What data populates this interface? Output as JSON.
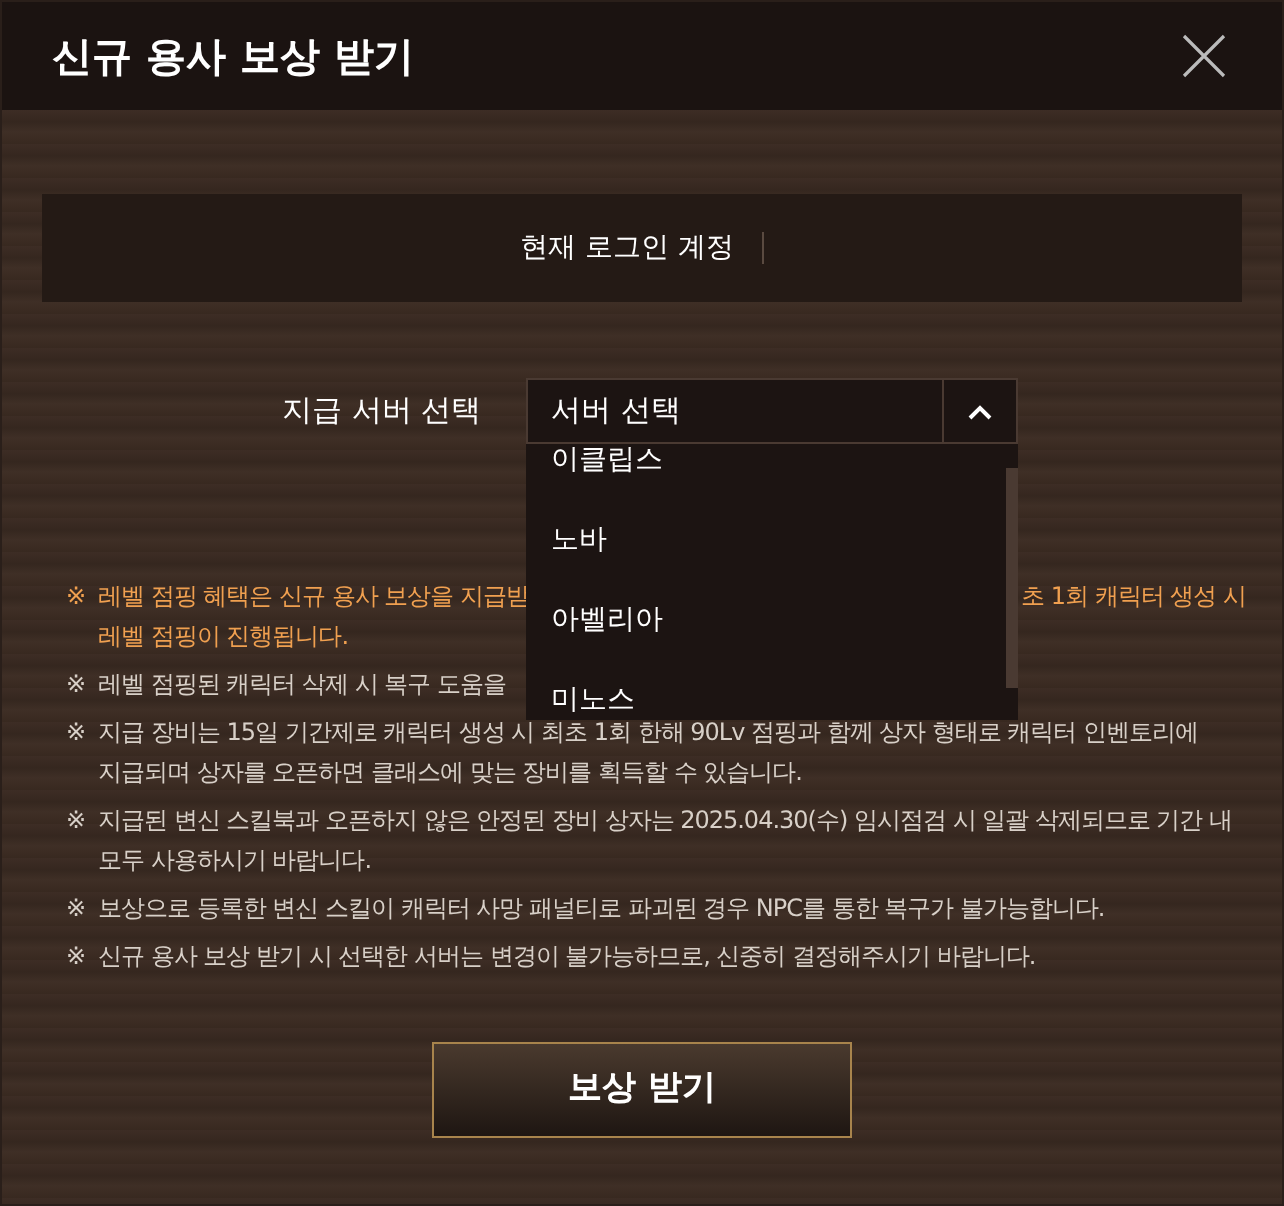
{
  "dialog": {
    "title": "신규 용사 보상 받기"
  },
  "account": {
    "label": "현재 로그인 계정"
  },
  "server_select": {
    "label": "지급 서버 선택",
    "value": "서버 선택",
    "expanded": true,
    "options": [
      {
        "label": "이클립스",
        "selected": false
      },
      {
        "label": "노바",
        "selected": false
      },
      {
        "label": "아벨리아",
        "selected": false
      },
      {
        "label": "미노스",
        "selected": false
      }
    ]
  },
  "notes": [
    {
      "mark": "※",
      "highlight": true,
      "lines": [
        [
          "레벨 점핑 혜택은 신규 용사 보상을 지급받",
          "초 1회 캐릭터 생성 시"
        ],
        [
          "레벨 점핑이 진행됩니다."
        ]
      ]
    },
    {
      "mark": "※",
      "highlight": false,
      "lines": [
        [
          "레벨 점핑된 캐릭터 삭제 시 복구 도움을"
        ]
      ]
    },
    {
      "mark": "※",
      "highlight": false,
      "lines": [
        [
          "지급 장비는 15일 기간제로 캐릭터 생성 시 최초 1회 한해 90Lv 점핑과 함께 상자 형태로 캐릭터 인벤토리에"
        ],
        [
          "지급되며 상자를 오픈하면 클래스에 맞는 장비를 획득할 수 있습니다."
        ]
      ]
    },
    {
      "mark": "※",
      "highlight": false,
      "lines": [
        [
          "지급된 변신 스킬북과 오픈하지 않은 안정된 장비 상자는 2025.04.30(수) 임시점검 시 일괄 삭제되므로 기간 내"
        ],
        [
          "모두 사용하시기 바랍니다."
        ]
      ]
    },
    {
      "mark": "※",
      "highlight": false,
      "lines": [
        [
          "보상으로 등록한 변신 스킬이 캐릭터 사망 패널티로 파괴된 경우 NPC를 통한 복구가 불가능합니다."
        ]
      ]
    },
    {
      "mark": "※",
      "highlight": false,
      "lines": [
        [
          "신규 용사 보상 받기 시 선택한 서버는 변경이 불가능하므로, 신중히 결정해주시기 바랍니다."
        ]
      ]
    }
  ],
  "submit_button": "보상 받기"
}
